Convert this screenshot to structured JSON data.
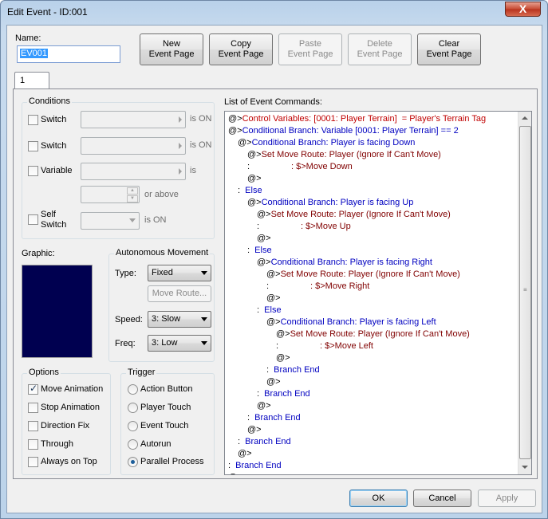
{
  "window": {
    "title": "Edit Event - ID:001",
    "close_symbol": "X"
  },
  "name": {
    "label": "Name:",
    "value": "EV001"
  },
  "top_buttons": {
    "new_page": [
      "New",
      "Event Page"
    ],
    "copy_page": [
      "Copy",
      "Event Page"
    ],
    "paste_page": [
      "Paste",
      "Event Page"
    ],
    "delete_page": [
      "Delete",
      "Event Page"
    ],
    "clear_page": [
      "Clear",
      "Event Page"
    ]
  },
  "tab": {
    "label": "1"
  },
  "conditions": {
    "title": "Conditions",
    "switch1": {
      "label": "Switch",
      "suffix": "is ON"
    },
    "switch2": {
      "label": "Switch",
      "suffix": "is ON"
    },
    "variable": {
      "label": "Variable",
      "suffix": "is",
      "suffix2": "or above"
    },
    "self_switch": {
      "label1": "Self",
      "label2": "Switch",
      "suffix": "is ON"
    }
  },
  "graphic": {
    "label": "Graphic:"
  },
  "autonomous": {
    "title": "Autonomous Movement",
    "type_label": "Type:",
    "type_value": "Fixed",
    "move_route": "Move Route...",
    "speed_label": "Speed:",
    "speed_value": "3: Slow",
    "freq_label": "Freq:",
    "freq_value": "3: Low"
  },
  "options": {
    "title": "Options",
    "items": [
      {
        "label": "Move Animation",
        "checked": true
      },
      {
        "label": "Stop Animation",
        "checked": false
      },
      {
        "label": "Direction Fix",
        "checked": false
      },
      {
        "label": "Through",
        "checked": false
      },
      {
        "label": "Always on Top",
        "checked": false
      }
    ]
  },
  "trigger": {
    "title": "Trigger",
    "items": [
      {
        "label": "Action Button",
        "selected": false
      },
      {
        "label": "Player Touch",
        "selected": false
      },
      {
        "label": "Event Touch",
        "selected": false
      },
      {
        "label": "Autorun",
        "selected": false
      },
      {
        "label": "Parallel Process",
        "selected": true
      }
    ]
  },
  "commands": {
    "label": "List of Event Commands:",
    "colors": {
      "red": "#c00000",
      "blue": "#0000c0",
      "darkred": "#800000"
    },
    "lines": [
      {
        "indent": 0,
        "prefix": "@>",
        "text": "Control Variables: [0001: Player Terrain]  = Player's Terrain Tag",
        "color": "red"
      },
      {
        "indent": 0,
        "prefix": "@>",
        "text": "Conditional Branch: Variable [0001: Player Terrain] == 2",
        "color": "blue"
      },
      {
        "indent": 1,
        "prefix": "@>",
        "text": "Conditional Branch: Player is facing Down",
        "color": "blue"
      },
      {
        "indent": 2,
        "prefix": "@>",
        "text": "Set Move Route: Player (Ignore If Can't Move)",
        "color": "darkred"
      },
      {
        "indent": 2,
        "prefix": " :",
        "text": "                 : $>Move Down",
        "color": "darkred"
      },
      {
        "indent": 2,
        "prefix": "@>",
        "text": "",
        "color": "blue"
      },
      {
        "indent": 1,
        "prefix": " :",
        "text": "  Else",
        "color": "blue"
      },
      {
        "indent": 2,
        "prefix": "@>",
        "text": "Conditional Branch: Player is facing Up",
        "color": "blue"
      },
      {
        "indent": 3,
        "prefix": "@>",
        "text": "Set Move Route: Player (Ignore If Can't Move)",
        "color": "darkred"
      },
      {
        "indent": 3,
        "prefix": " :",
        "text": "                 : $>Move Up",
        "color": "darkred"
      },
      {
        "indent": 3,
        "prefix": "@>",
        "text": "",
        "color": "blue"
      },
      {
        "indent": 2,
        "prefix": " :",
        "text": "  Else",
        "color": "blue"
      },
      {
        "indent": 3,
        "prefix": "@>",
        "text": "Conditional Branch: Player is facing Right",
        "color": "blue"
      },
      {
        "indent": 4,
        "prefix": "@>",
        "text": "Set Move Route: Player (Ignore If Can't Move)",
        "color": "darkred"
      },
      {
        "indent": 4,
        "prefix": " :",
        "text": "                 : $>Move Right",
        "color": "darkred"
      },
      {
        "indent": 4,
        "prefix": "@>",
        "text": "",
        "color": "blue"
      },
      {
        "indent": 3,
        "prefix": " :",
        "text": "  Else",
        "color": "blue"
      },
      {
        "indent": 4,
        "prefix": "@>",
        "text": "Conditional Branch: Player is facing Left",
        "color": "blue"
      },
      {
        "indent": 5,
        "prefix": "@>",
        "text": "Set Move Route: Player (Ignore If Can't Move)",
        "color": "darkred"
      },
      {
        "indent": 5,
        "prefix": " :",
        "text": "                 : $>Move Left",
        "color": "darkred"
      },
      {
        "indent": 5,
        "prefix": "@>",
        "text": "",
        "color": "blue"
      },
      {
        "indent": 4,
        "prefix": " :",
        "text": "  Branch End",
        "color": "blue"
      },
      {
        "indent": 4,
        "prefix": "@>",
        "text": "",
        "color": "blue"
      },
      {
        "indent": 3,
        "prefix": " :",
        "text": "  Branch End",
        "color": "blue"
      },
      {
        "indent": 3,
        "prefix": "@>",
        "text": "",
        "color": "blue"
      },
      {
        "indent": 2,
        "prefix": " :",
        "text": "  Branch End",
        "color": "blue"
      },
      {
        "indent": 2,
        "prefix": "@>",
        "text": "",
        "color": "blue"
      },
      {
        "indent": 1,
        "prefix": " :",
        "text": "  Branch End",
        "color": "blue"
      },
      {
        "indent": 1,
        "prefix": "@>",
        "text": "",
        "color": "blue"
      },
      {
        "indent": 0,
        "prefix": " :",
        "text": "  Branch End",
        "color": "blue"
      },
      {
        "indent": 0,
        "prefix": "@>",
        "text": "",
        "color": "blue"
      }
    ]
  },
  "bottom_buttons": {
    "ok": "OK",
    "cancel": "Cancel",
    "apply": "Apply"
  }
}
